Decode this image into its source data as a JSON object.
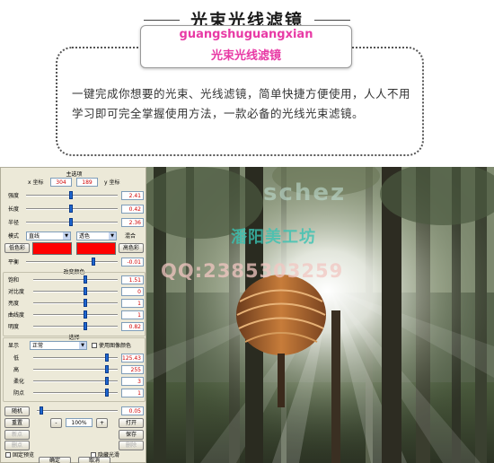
{
  "header": {
    "title": "光束光线滤镜",
    "subtitle_pinyin": "guangshuguangxian",
    "subtitle_cn": "光束光线滤镜",
    "description": "一键完成你想要的光束、光线滤镜，简单快捷方便使用，人人不用学习即可完全掌握使用方法，一款必备的光线光束滤镜。"
  },
  "panel": {
    "main_label": "主选项",
    "x_label": "x 坐标",
    "x_value": "304",
    "y_value": "189",
    "y_label": "y 坐标",
    "sliders_top": [
      {
        "label": "强度",
        "value": "2.41",
        "level": 0.48
      },
      {
        "label": "长度",
        "value": "0.42",
        "level": 0.48
      },
      {
        "label": "半径",
        "value": "2.36",
        "level": 0.48
      }
    ],
    "mode_label": "模式",
    "mode_value": "直线",
    "color_mode_value": "透色",
    "mix_label": "混合",
    "low_color_label": "低色彩",
    "high_color_label": "高色彩",
    "swatch_color": "#ff0000",
    "balance_label": "平衡",
    "balance_value": "-0.01",
    "balance_level": 0.72,
    "color_section_label": "改变颜色",
    "color_sliders": [
      {
        "label": "饱和",
        "value": "1.51",
        "level": 0.6
      },
      {
        "label": "对比度",
        "value": "0",
        "level": 0.6
      },
      {
        "label": "亮度",
        "value": "1",
        "level": 0.6
      },
      {
        "label": "曲线度",
        "value": "1",
        "level": 0.6
      },
      {
        "label": "明度",
        "value": "0.82",
        "level": 0.6
      }
    ],
    "options_label": "选择",
    "display_label": "显示",
    "display_value": "正常",
    "use_image_color_label": "使用图像颜色",
    "option_sliders": [
      {
        "label": "低",
        "value": "125.43",
        "level": 0.85
      },
      {
        "label": "高",
        "value": "255",
        "level": 0.85
      },
      {
        "label": "柔化",
        "value": "3",
        "level": 0.85
      },
      {
        "label": "阴点",
        "value": "1",
        "level": 0.85
      }
    ],
    "random_label": "随机",
    "random_value": "0.05",
    "reset_label": "重置",
    "zoom_minus": "-",
    "zoom_value": "100%",
    "zoom_plus": "+",
    "open_label": "打开",
    "new_label": "新点",
    "save_label": "保存",
    "delete_label": "删点",
    "delete2_label": "删除",
    "fixed_preview_label": "固定预览",
    "hide_preview_label": "隐藏光滑",
    "ok_label": "确定",
    "cancel_label": "取消"
  },
  "watermark": {
    "brand": "schez",
    "brand_cn": "潘阳美工坊",
    "qq": "QQ:2385303259"
  },
  "colors": {
    "pink_accent": "#e83aa5",
    "slider_blue": "#1e66d0",
    "value_red": "#d00000",
    "panel_bg": "#ece9d8"
  }
}
